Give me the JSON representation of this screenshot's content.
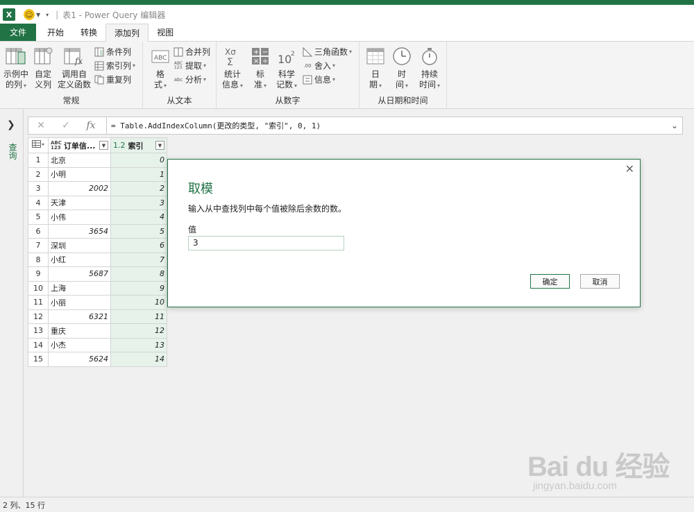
{
  "window": {
    "title": "表1 - Power Query 编辑器",
    "app_icon": "X"
  },
  "tabs": [
    {
      "label": "文件"
    },
    {
      "label": "开始"
    },
    {
      "label": "转换"
    },
    {
      "label": "添加列"
    },
    {
      "label": "视图"
    }
  ],
  "ribbon": {
    "groups": {
      "general": {
        "label": "常规",
        "examples_col_l1": "示例中",
        "examples_col_l2": "的列",
        "custom_col_l1": "自定",
        "custom_col_l2": "义列",
        "invoke_fn_l1": "调用自",
        "invoke_fn_l2": "定义函数",
        "conditional_col": "条件列",
        "index_col": "索引列",
        "duplicate_col": "重复列"
      },
      "from_text": {
        "label": "从文本",
        "format_l1": "格",
        "format_l2": "式",
        "merge_cols": "合并列",
        "extract": "提取",
        "parse": "分析"
      },
      "from_number": {
        "label": "从数字",
        "statistics_l1": "统计",
        "statistics_l2": "信息",
        "standard_l1": "标",
        "standard_l2": "准",
        "scientific_l1": "科学",
        "scientific_l2": "记数",
        "trig": "三角函数",
        "rounding": "舍入",
        "information": "信息"
      },
      "from_datetime": {
        "label": "从日期和时间",
        "date_l1": "日",
        "date_l2": "期",
        "time_l1": "时",
        "time_l2": "间",
        "duration_l1": "持续",
        "duration_l2": "时间"
      }
    }
  },
  "nav": {
    "label": "查询"
  },
  "formula_bar": {
    "cancel_glyph": "✕",
    "commit_glyph": "✓",
    "fx_glyph": "fx",
    "formula": "= Table.AddIndexColumn(更改的类型, \"索引\", 0, 1)"
  },
  "grid": {
    "columns": [
      {
        "name": "订单信...",
        "type_label": "ABC 123"
      },
      {
        "name": "索引",
        "type_label": "1.2"
      }
    ],
    "rows": [
      {
        "n": "1",
        "a": "北京",
        "b": "0"
      },
      {
        "n": "2",
        "a": "小明",
        "b": "1"
      },
      {
        "n": "3",
        "a": "2002",
        "b": "2"
      },
      {
        "n": "4",
        "a": "天津",
        "b": "3"
      },
      {
        "n": "5",
        "a": "小伟",
        "b": "4"
      },
      {
        "n": "6",
        "a": "3654",
        "b": "5"
      },
      {
        "n": "7",
        "a": "深圳",
        "b": "6"
      },
      {
        "n": "8",
        "a": "小红",
        "b": "7"
      },
      {
        "n": "9",
        "a": "5687",
        "b": "8"
      },
      {
        "n": "10",
        "a": "上海",
        "b": "9"
      },
      {
        "n": "11",
        "a": "小丽",
        "b": "10"
      },
      {
        "n": "12",
        "a": "6321",
        "b": "11"
      },
      {
        "n": "13",
        "a": "重庆",
        "b": "12"
      },
      {
        "n": "14",
        "a": "小杰",
        "b": "13"
      },
      {
        "n": "15",
        "a": "5624",
        "b": "14"
      }
    ]
  },
  "dialog": {
    "title": "取模",
    "description": "输入从中查找列中每个值被除后余数的数。",
    "value_label": "值",
    "value": "3",
    "ok_label": "确定",
    "cancel_label": "取消",
    "close_glyph": "✕"
  },
  "status": {
    "text": "2 列、15 行"
  },
  "watermark": {
    "main": "Bai du 经验",
    "sub": "jingyan.baidu.com"
  },
  "colors": {
    "accent": "#217346",
    "index_column_bg": "#e6f2ea"
  }
}
